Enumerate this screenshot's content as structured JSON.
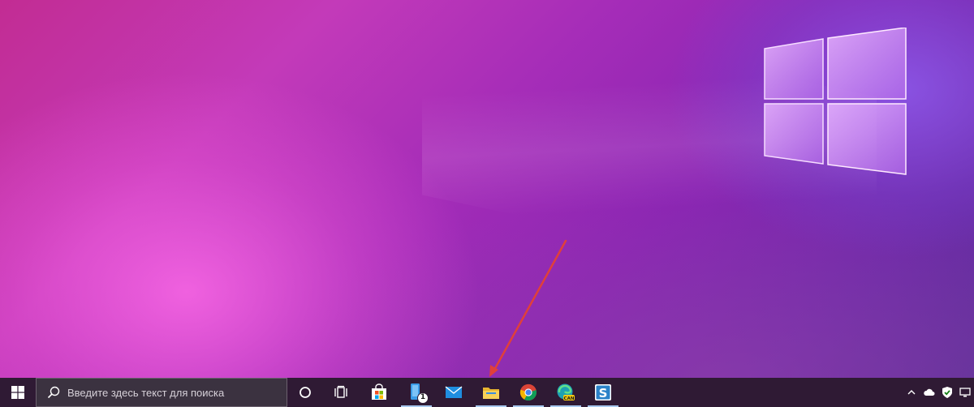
{
  "desktop": {
    "wallpaper": "windows-10-logo-pink-purple",
    "colors": {
      "accent_pink": "#f15ce0",
      "accent_purple": "#7a2bb0",
      "logo_glow": "#e8b8ff"
    }
  },
  "annotation": {
    "type": "red-arrow",
    "color": "#e0403a",
    "target": "file-explorer-taskbar-button"
  },
  "taskbar": {
    "background": "#2f1a34",
    "start_icon": "windows-start-icon",
    "search": {
      "icon": "search-icon",
      "placeholder": "Введите здесь текст для поиска"
    },
    "cortana_icon": "cortana-circle-icon",
    "task_view_icon": "task-view-icon",
    "apps": [
      {
        "name": "Microsoft Store",
        "icon": "store-icon",
        "running": false
      },
      {
        "name": "Phone",
        "icon": "phone-app-icon",
        "running": true,
        "badge": "1"
      },
      {
        "name": "Mail",
        "icon": "mail-icon",
        "running": false
      },
      {
        "name": "File Explorer",
        "icon": "file-explorer-icon",
        "running": true
      },
      {
        "name": "Google Chrome",
        "icon": "chrome-icon",
        "running": true
      },
      {
        "name": "Microsoft Edge Canary",
        "icon": "edge-canary-icon",
        "running": true,
        "badge_text": "CAN"
      },
      {
        "name": "Snagit",
        "icon": "snagit-icon",
        "running": true
      }
    ],
    "tray": [
      {
        "icon": "chevron-up-icon"
      },
      {
        "icon": "onedrive-cloud-icon"
      },
      {
        "icon": "defender-shield-icon"
      },
      {
        "icon": "network-icon"
      }
    ]
  }
}
